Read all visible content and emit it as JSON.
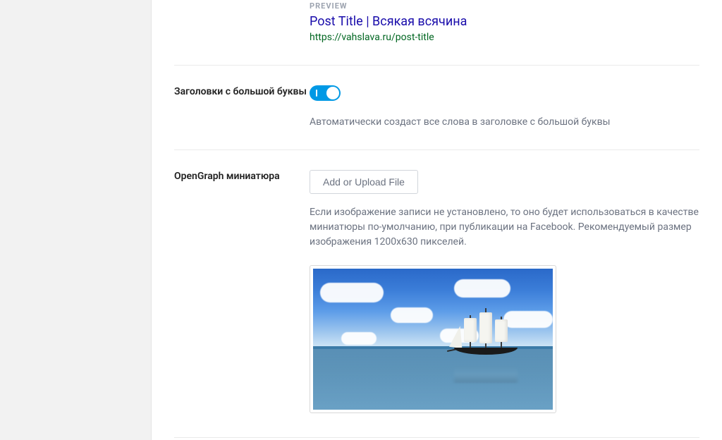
{
  "preview": {
    "label": "PREVIEW",
    "title": "Post Title | Всякая всячина",
    "url": "https://vahslava.ru/post-title"
  },
  "capitalize": {
    "label": "Заголовки с большой буквы",
    "helper": "Автоматически создаст все слова в заголовке с большой буквы",
    "enabled": true
  },
  "og_thumb": {
    "label": "OpenGraph миниатюра",
    "button": "Add or Upload File",
    "helper": "Если изображение записи не установлено, то оно будет использоваться в качестве миниатюры по-умолчанию, при публикации на Facebook. Рекомендуемый размер изображения 1200х630 пикселей."
  }
}
